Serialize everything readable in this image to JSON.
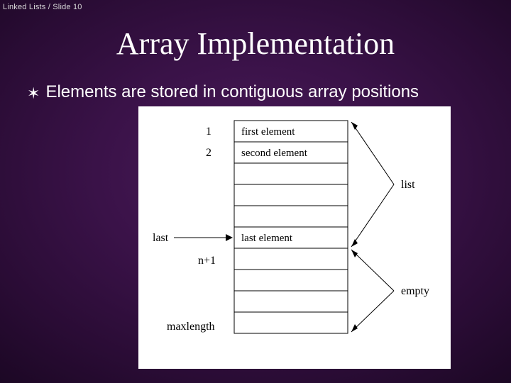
{
  "header": "Linked Lists / Slide 10",
  "title": "Array Implementation",
  "bullet_text": "Elements are stored in contiguous array positions",
  "diagram": {
    "row_labels": {
      "idx1": "1",
      "idx2": "2",
      "last": "last",
      "nplus1": "n+1",
      "maxlength": "maxlength"
    },
    "cell_text": {
      "first": "first element",
      "second": "second element",
      "last": "last element"
    },
    "side_labels": {
      "list": "list",
      "empty": "empty"
    }
  }
}
